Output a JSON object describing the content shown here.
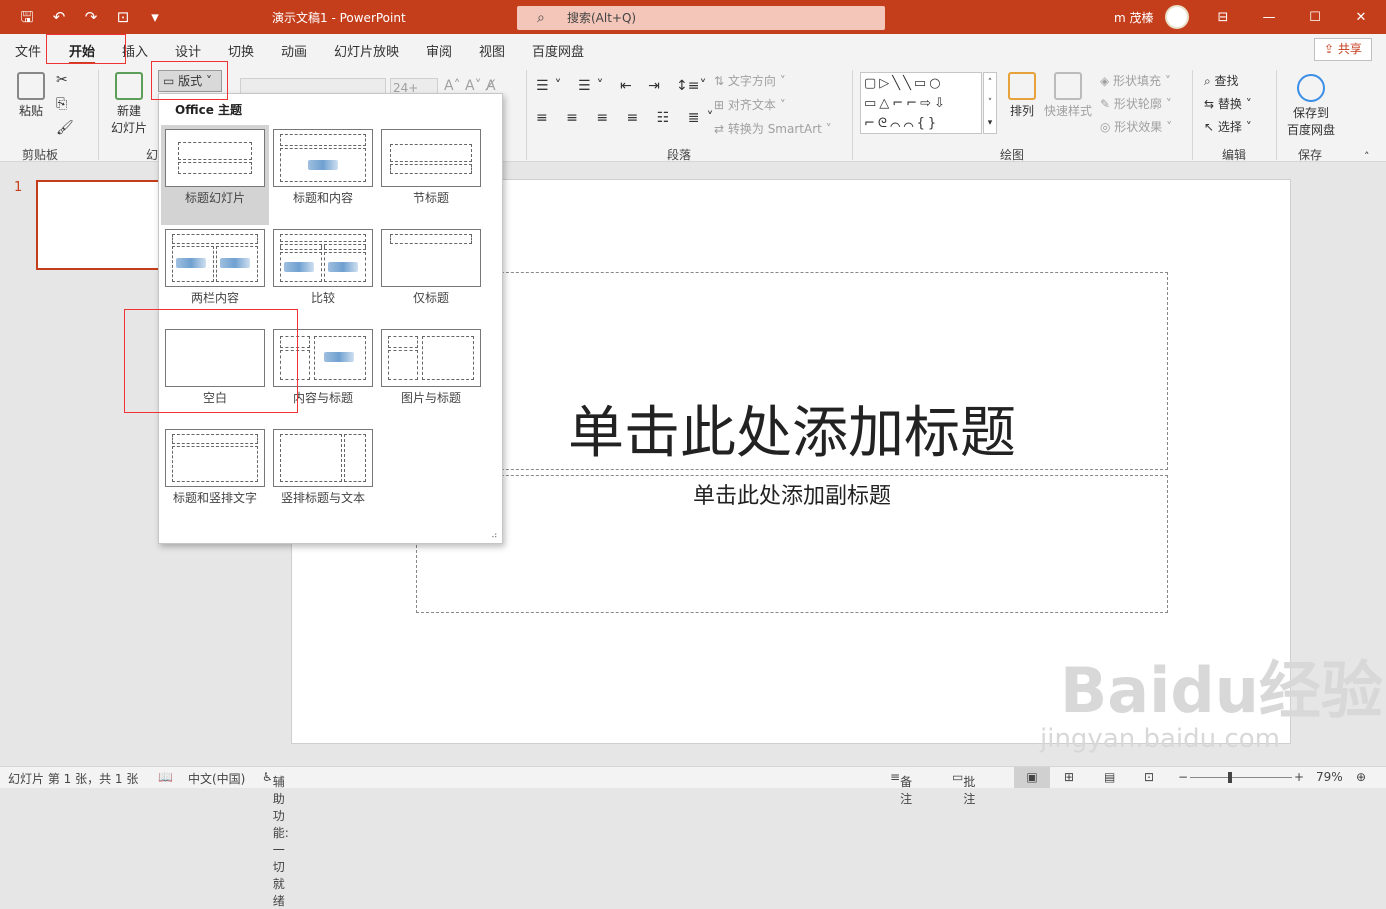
{
  "app": {
    "doc_title": "演示文稿1  -  PowerPoint",
    "search_placeholder": "搜索(Alt+Q)",
    "user": "m 茂榛",
    "share": "共享",
    "accent": "#c43e1c"
  },
  "tabs": [
    "文件",
    "开始",
    "插入",
    "设计",
    "切换",
    "动画",
    "幻灯片放映",
    "审阅",
    "视图",
    "百度网盘"
  ],
  "ribbon": {
    "clipboard": {
      "paste": "粘贴",
      "label": "剪贴板"
    },
    "slides": {
      "new_slide": "新建",
      "new_slide2": "幻灯片",
      "layout_btn": "版式",
      "label": "幻"
    },
    "font": {
      "size": "24+"
    },
    "paragraph": {
      "text_direction": "文字方向",
      "align_text": "对齐文本",
      "convert_smartart": "转换为 SmartArt",
      "label": "段落"
    },
    "drawing": {
      "arrange": "排列",
      "quick_styles": "快速样式",
      "shape_fill": "形状填充",
      "shape_outline": "形状轮廓",
      "shape_effects": "形状效果",
      "label": "绘图"
    },
    "editing": {
      "find": "查找",
      "replace": "替换",
      "select": "选择",
      "label": "编辑"
    },
    "save": {
      "save_to": "保存到",
      "baidu": "百度网盘",
      "label": "保存"
    }
  },
  "thumbnail": {
    "number": "1"
  },
  "slide": {
    "title_placeholder": "单击此处添加标题",
    "subtitle_placeholder": "单击此处添加副标题"
  },
  "layout_gallery": {
    "header": "Office 主题",
    "layouts": [
      "标题幻灯片",
      "标题和内容",
      "节标题",
      "两栏内容",
      "比较",
      "仅标题",
      "空白",
      "内容与标题",
      "图片与标题",
      "标题和竖排文字",
      "竖排标题与文本"
    ]
  },
  "statusbar": {
    "slide_count": "幻灯片 第 1 张，共 1 张",
    "language": "中文(中国)",
    "accessibility": "辅助功能: 一切就绪",
    "notes": "备注",
    "comments": "批注",
    "zoom": "79%"
  },
  "watermark": {
    "logo": "Baidu经验",
    "url": "jingyan.baidu.com"
  },
  "icons": [
    "save-icon",
    "undo-icon",
    "redo-icon",
    "present-icon",
    "search-icon",
    "minimize-icon",
    "maximize-icon",
    "close-icon"
  ]
}
